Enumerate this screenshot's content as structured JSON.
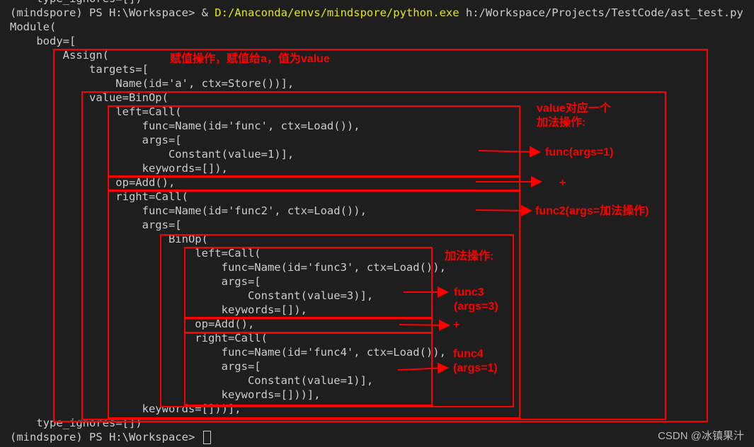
{
  "terminal": {
    "lines": [
      "    type_ignores=[])",
      "(mindspore) PS H:\\Workspace> & ",
      "Module(",
      "    body=[",
      "        Assign(",
      "            targets=[",
      "                Name(id='a', ctx=Store())],",
      "            value=BinOp(",
      "                left=Call(",
      "                    func=Name(id='func', ctx=Load()),",
      "                    args=[",
      "                        Constant(value=1)],",
      "                    keywords=[]),",
      "                op=Add(),",
      "                right=Call(",
      "                    func=Name(id='func2', ctx=Load()),",
      "                    args=[",
      "                        BinOp(",
      "                            left=Call(",
      "                                func=Name(id='func3', ctx=Load()),",
      "                                args=[",
      "                                    Constant(value=3)],",
      "                                keywords=[]),",
      "                            op=Add(),",
      "                            right=Call(",
      "                                func=Name(id='func4', ctx=Load()),",
      "                                args=[",
      "                                    Constant(value=1)],",
      "                                keywords=[]))],",
      "                    keywords=[]))],",
      "    type_ignores=[])",
      "(mindspore) PS H:\\Workspace> "
    ],
    "command_exe": "D:/Anaconda/envs/mindspore/python.exe",
    "command_arg": " h:/Workspace/Projects/TestCode/ast_test.py"
  },
  "annotations": {
    "assign": "赋值操作，赋值给a，值为value",
    "value": "value对应一个\n加法操作:",
    "func": "func(args=1)",
    "plus1": "+",
    "func2": "func2(args=加法操作)",
    "inner": "加法操作:",
    "func3": "func3\n(args=3)",
    "plus2": "+",
    "func4": "func4\n(args=1)"
  },
  "watermark": "CSDN @冰镇果汁",
  "colors": {
    "background": "#1e1e1e",
    "text": "#cccccc",
    "command": "#e5e510",
    "annotation": "#ff0000"
  }
}
